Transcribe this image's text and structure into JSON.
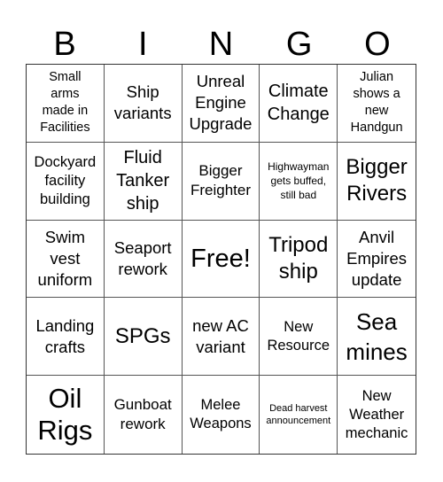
{
  "header": {
    "letters": [
      "B",
      "I",
      "N",
      "G",
      "O"
    ]
  },
  "cells": [
    "Small arms made in Facilities",
    "Ship variants",
    "Unreal Engine Upgrade",
    "Climate Change",
    "Julian shows a new Handgun",
    "Dockyard facility building",
    "Fluid Tanker ship",
    "Bigger Freighter",
    "Highwayman gets buffed, still bad",
    "Bigger Rivers",
    "Swim vest uniform",
    "Seaport rework",
    "Free!",
    "Tripod ship",
    "Anvil Empires update",
    "Landing crafts",
    "SPGs",
    "new AC variant",
    "New Resource",
    "Sea mines",
    "Oil Rigs",
    "Gunboat rework",
    "Melee Weapons",
    "Dead harvest announcement",
    "New Weather mechanic"
  ]
}
